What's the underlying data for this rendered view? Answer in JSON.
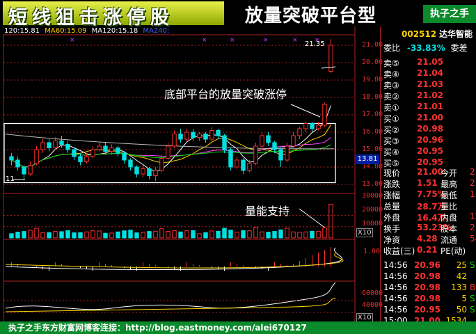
{
  "header": {
    "title_left": "短线狙击涨停股",
    "title_center": "放量突破平台型",
    "title_right": "执子之手"
  },
  "ma_bar": {
    "ma20": "120:15.81",
    "ma60": "MA60:15.09",
    "ma120": "MA120:15.18",
    "ma240": "MA240:"
  },
  "price_axis": [
    "21.00",
    "20.00",
    "19.00",
    "18.00",
    "17.00",
    "16.00",
    "15.00",
    "14.00",
    "13.00"
  ],
  "vol_axis": [
    "30000",
    "20000",
    "10000"
  ],
  "macd_axis": [
    "1.00"
  ],
  "obv_axis": [
    "60000",
    "40000"
  ],
  "marks": {
    "high_label": "21.35",
    "low_label": "11",
    "current_price_tag": "13.81",
    "x10_1": "X10",
    "x10_2": "X10"
  },
  "annotations": {
    "platform": "底部平台的放量突破涨停",
    "volume": "量能支持"
  },
  "quote": {
    "code": "002512",
    "name": "达华智能",
    "weibi_label": "委比",
    "weibi_value": "-33.83%",
    "weicha_label": "委差",
    "sells": [
      {
        "label": "卖⑤",
        "price": "21.05"
      },
      {
        "label": "卖④",
        "price": "21.04"
      },
      {
        "label": "卖③",
        "price": "21.03"
      },
      {
        "label": "卖②",
        "price": "21.02"
      },
      {
        "label": "卖①",
        "price": "21.01"
      }
    ],
    "buys": [
      {
        "label": "买①",
        "price": "21.00"
      },
      {
        "label": "买②",
        "price": "20.98"
      },
      {
        "label": "买③",
        "price": "20.96"
      },
      {
        "label": "买④",
        "price": "20.95"
      },
      {
        "label": "买⑤",
        "price": "20.95"
      }
    ],
    "stats": [
      {
        "l1": "现价",
        "v1": "21.00",
        "l2": "今开",
        "v2": "2"
      },
      {
        "l1": "涨跌",
        "v1": "1.51",
        "l2": "最高",
        "v2": "2"
      },
      {
        "l1": "涨幅",
        "v1": "7.75%",
        "l2": "最低",
        "v2": "1"
      },
      {
        "l1": "总量",
        "v1": "28.7万",
        "l2": "量比",
        "v2": ""
      },
      {
        "l1": "外盘",
        "v1": "16.4万",
        "l2": "内盘",
        "v2": "12"
      },
      {
        "l1": "换手",
        "v1": "53.23%",
        "l2": "股本",
        "v2": "2."
      },
      {
        "l1": "净资",
        "v1": "4.28",
        "l2": "流通",
        "v2": "54"
      },
      {
        "l1": "收益(三)",
        "v1": "0.21",
        "l2": "PE(动)",
        "v2": ""
      }
    ],
    "ticks": [
      {
        "time": "14:56",
        "price": "20.96",
        "vol": "25",
        "dir": "S"
      },
      {
        "time": "14:56",
        "price": "20.98",
        "vol": "42",
        "dir": ""
      },
      {
        "time": "14:56",
        "price": "20.98",
        "vol": "133",
        "dir": "B"
      },
      {
        "time": "14:56",
        "price": "20.98",
        "vol": "5",
        "dir": "S"
      },
      {
        "time": "14:56",
        "price": "20.95",
        "vol": "50",
        "dir": "S"
      },
      {
        "time": "15:00",
        "price": "21.00",
        "vol": "1534",
        "dir": ""
      }
    ]
  },
  "footer": {
    "text": "执子之手东方财富网博客连接：http://blog.eastmoney.com/alei670127"
  },
  "colors": {
    "up": "#ff3030",
    "down": "#00e0e0",
    "accent": "#ffd400",
    "frame": "#b02020"
  },
  "chart_data": {
    "type": "candlestick",
    "candles": [
      [
        14.6,
        14.4,
        14.8,
        14.1
      ],
      [
        14.4,
        14.0,
        14.6,
        13.8
      ],
      [
        14.0,
        13.6,
        14.1,
        13.3
      ],
      [
        13.6,
        14.1,
        14.3,
        13.5
      ],
      [
        14.2,
        15.0,
        15.2,
        14.1
      ],
      [
        15.0,
        15.4,
        15.6,
        14.8
      ],
      [
        15.4,
        15.1,
        15.6,
        14.9
      ],
      [
        15.1,
        15.5,
        15.7,
        15.0
      ],
      [
        15.5,
        15.3,
        15.8,
        15.1
      ],
      [
        15.3,
        15.0,
        15.5,
        14.8
      ],
      [
        15.0,
        14.6,
        15.1,
        14.4
      ],
      [
        14.6,
        14.3,
        14.8,
        14.1
      ],
      [
        14.3,
        14.6,
        14.8,
        14.2
      ],
      [
        14.6,
        15.0,
        15.2,
        14.5
      ],
      [
        15.0,
        15.2,
        15.4,
        14.9
      ],
      [
        15.2,
        14.9,
        15.4,
        14.7
      ],
      [
        14.9,
        15.1,
        15.3,
        14.7
      ],
      [
        15.1,
        14.8,
        15.2,
        14.6
      ],
      [
        14.8,
        14.4,
        14.9,
        14.2
      ],
      [
        14.4,
        14.0,
        14.5,
        13.8
      ],
      [
        14.0,
        13.6,
        14.1,
        13.4
      ],
      [
        13.6,
        13.9,
        14.1,
        13.4
      ],
      [
        13.9,
        13.5,
        14.0,
        13.3
      ],
      [
        13.5,
        13.8,
        14.0,
        13.2
      ],
      [
        13.8,
        14.5,
        14.7,
        13.7
      ],
      [
        14.5,
        15.2,
        15.4,
        14.4
      ],
      [
        15.2,
        15.9,
        16.1,
        15.1
      ],
      [
        15.9,
        15.6,
        16.2,
        15.4
      ],
      [
        15.6,
        16.0,
        16.2,
        15.5
      ],
      [
        16.0,
        15.7,
        16.2,
        15.5
      ],
      [
        15.7,
        15.9,
        16.0,
        15.5
      ],
      [
        15.9,
        15.6,
        16.0,
        15.4
      ],
      [
        15.6,
        16.1,
        16.3,
        15.5
      ],
      [
        16.1,
        15.8,
        16.2,
        15.6
      ],
      [
        15.8,
        15.0,
        15.9,
        14.8
      ],
      [
        15.0,
        14.0,
        15.1,
        13.8
      ],
      [
        14.0,
        14.4,
        14.6,
        13.9
      ],
      [
        14.4,
        13.8,
        14.5,
        13.6
      ],
      [
        13.8,
        14.2,
        14.4,
        13.7
      ],
      [
        14.2,
        15.2,
        15.4,
        14.1
      ],
      [
        15.2,
        15.8,
        16.0,
        15.0
      ],
      [
        15.8,
        15.4,
        16.0,
        15.2
      ],
      [
        15.4,
        15.0,
        15.5,
        14.8
      ],
      [
        15.0,
        14.4,
        15.1,
        14.0
      ],
      [
        14.4,
        15.2,
        15.4,
        14.3
      ],
      [
        15.2,
        15.8,
        16.0,
        15.1
      ],
      [
        15.8,
        16.2,
        16.3,
        15.6
      ],
      [
        16.2,
        16.5,
        16.6,
        16.0
      ],
      [
        16.5,
        16.2,
        16.6,
        16.0
      ],
      [
        16.2,
        16.4,
        16.6,
        16.1
      ],
      [
        16.4,
        17.6,
        17.7,
        16.3
      ],
      [
        19.5,
        21.0,
        21.35,
        19.4
      ]
    ]
  }
}
